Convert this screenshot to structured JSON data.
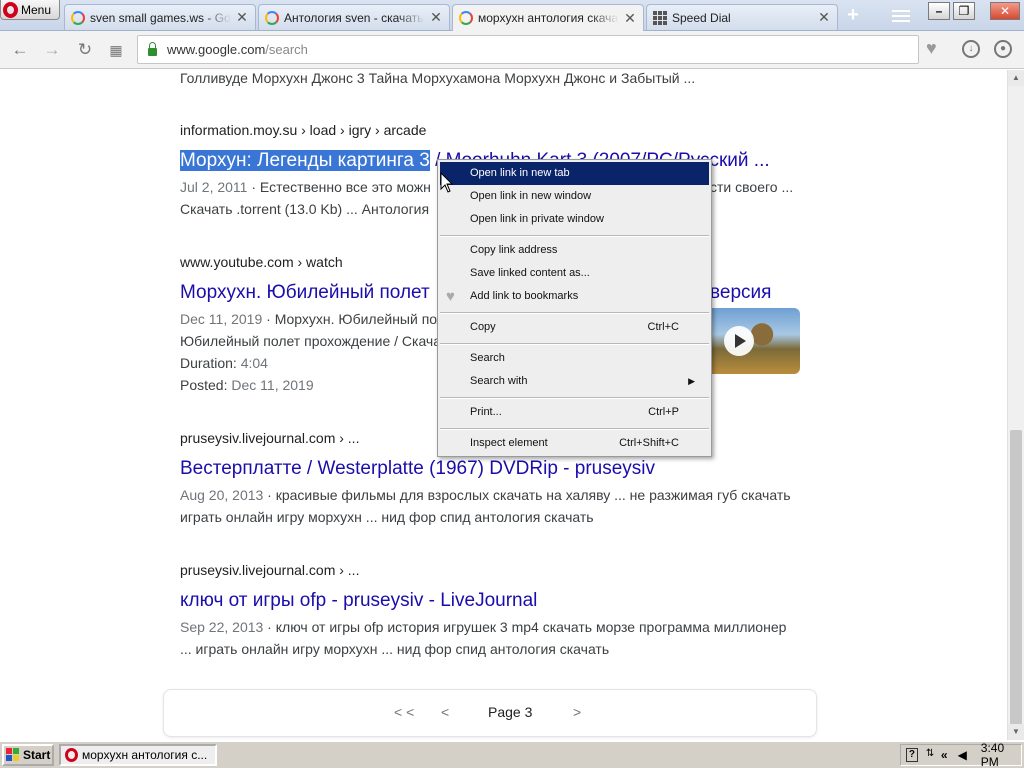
{
  "browser": {
    "menu_label": "Menu",
    "tabs": [
      {
        "title": "sven small games.ws - Google",
        "icon": "google-icon",
        "active": false
      },
      {
        "title": "Антология sven - скачать и",
        "icon": "google-icon",
        "active": false
      },
      {
        "title": "морхухн антология скачать",
        "icon": "google-icon",
        "active": true
      },
      {
        "title": "Speed Dial",
        "icon": "speed-dial-icon",
        "active": false
      }
    ],
    "new_tab": "+",
    "url_host": "www.google.com",
    "url_path": "/search"
  },
  "results": {
    "top_snippet": "Голливуде Морхухн Джонс 3 Тайна Морхухамона Морхухн Джонс и Забытый ...",
    "items": [
      {
        "cite": "information.moy.su › load › igry › arcade",
        "title_highlight": "Морхун: Легенды картинга 3",
        "title_rest": " / Moorhuhn Kart 3 (2007/PC/Русский ...",
        "date": "Jul 2, 2011",
        "snippet1": " · Естественно все это можн",
        "snippet1_end": "сти своего ...",
        "snippet2": "Скачать .torrent (13.0 Kb) ... Антология"
      },
      {
        "cite": "www.youtube.com › watch",
        "title": "Морхухн. Юбилейный полет",
        "title_end": "версия",
        "date": "Dec 11, 2019",
        "snippet1": " · Морхухн. Юбилейный пол",
        "snippet2": "Юбилейный полет прохождение / Скача",
        "duration_label": "Duration:",
        "duration": "4:04",
        "posted_label": "Posted:",
        "posted": "Dec 11, 2019"
      },
      {
        "cite": "pruseysiv.livejournal.com › ...",
        "title": "Вестерплатте / Westerplatte (1967) DVDRip - pruseysiv",
        "date": "Aug 20, 2013",
        "snippet1": " · красивые фильмы для взрослых скачать на халяву ... не разжимая губ скачать",
        "snippet2": "играть онлайн игру морхухн ... нид фор спид антология скачать"
      },
      {
        "cite": "pruseysiv.livejournal.com › ...",
        "title": "ключ от игры ofp - pruseysiv - LiveJournal",
        "date": "Sep 22, 2013",
        "snippet1": " · ключ от игры ofp история игрушек 3 mp4 скачать морзе программа миллионер",
        "snippet2": "... играть онлайн игру морхухн ... нид фор спид антология скачать"
      }
    ]
  },
  "pager": {
    "first": "< <",
    "prev": "<",
    "page": "Page 3",
    "next": ">"
  },
  "context_menu": {
    "open_new_tab": "Open link in new tab",
    "open_new_window": "Open link in new window",
    "open_private": "Open link in private window",
    "copy_address": "Copy link address",
    "save_linked": "Save linked content as...",
    "add_bookmark": "Add link to bookmarks",
    "copy": "Copy",
    "copy_shortcut": "Ctrl+C",
    "search": "Search",
    "search_with": "Search with",
    "print": "Print...",
    "print_shortcut": "Ctrl+P",
    "inspect": "Inspect element",
    "inspect_shortcut": "Ctrl+Shift+C"
  },
  "taskbar": {
    "start": "Start",
    "task_title": "морхухн антология с...",
    "clock": "3:40 PM"
  },
  "colors": {
    "link": "#1a0dab",
    "highlight": "#3a76d6",
    "menu_active": "#0a246a"
  }
}
